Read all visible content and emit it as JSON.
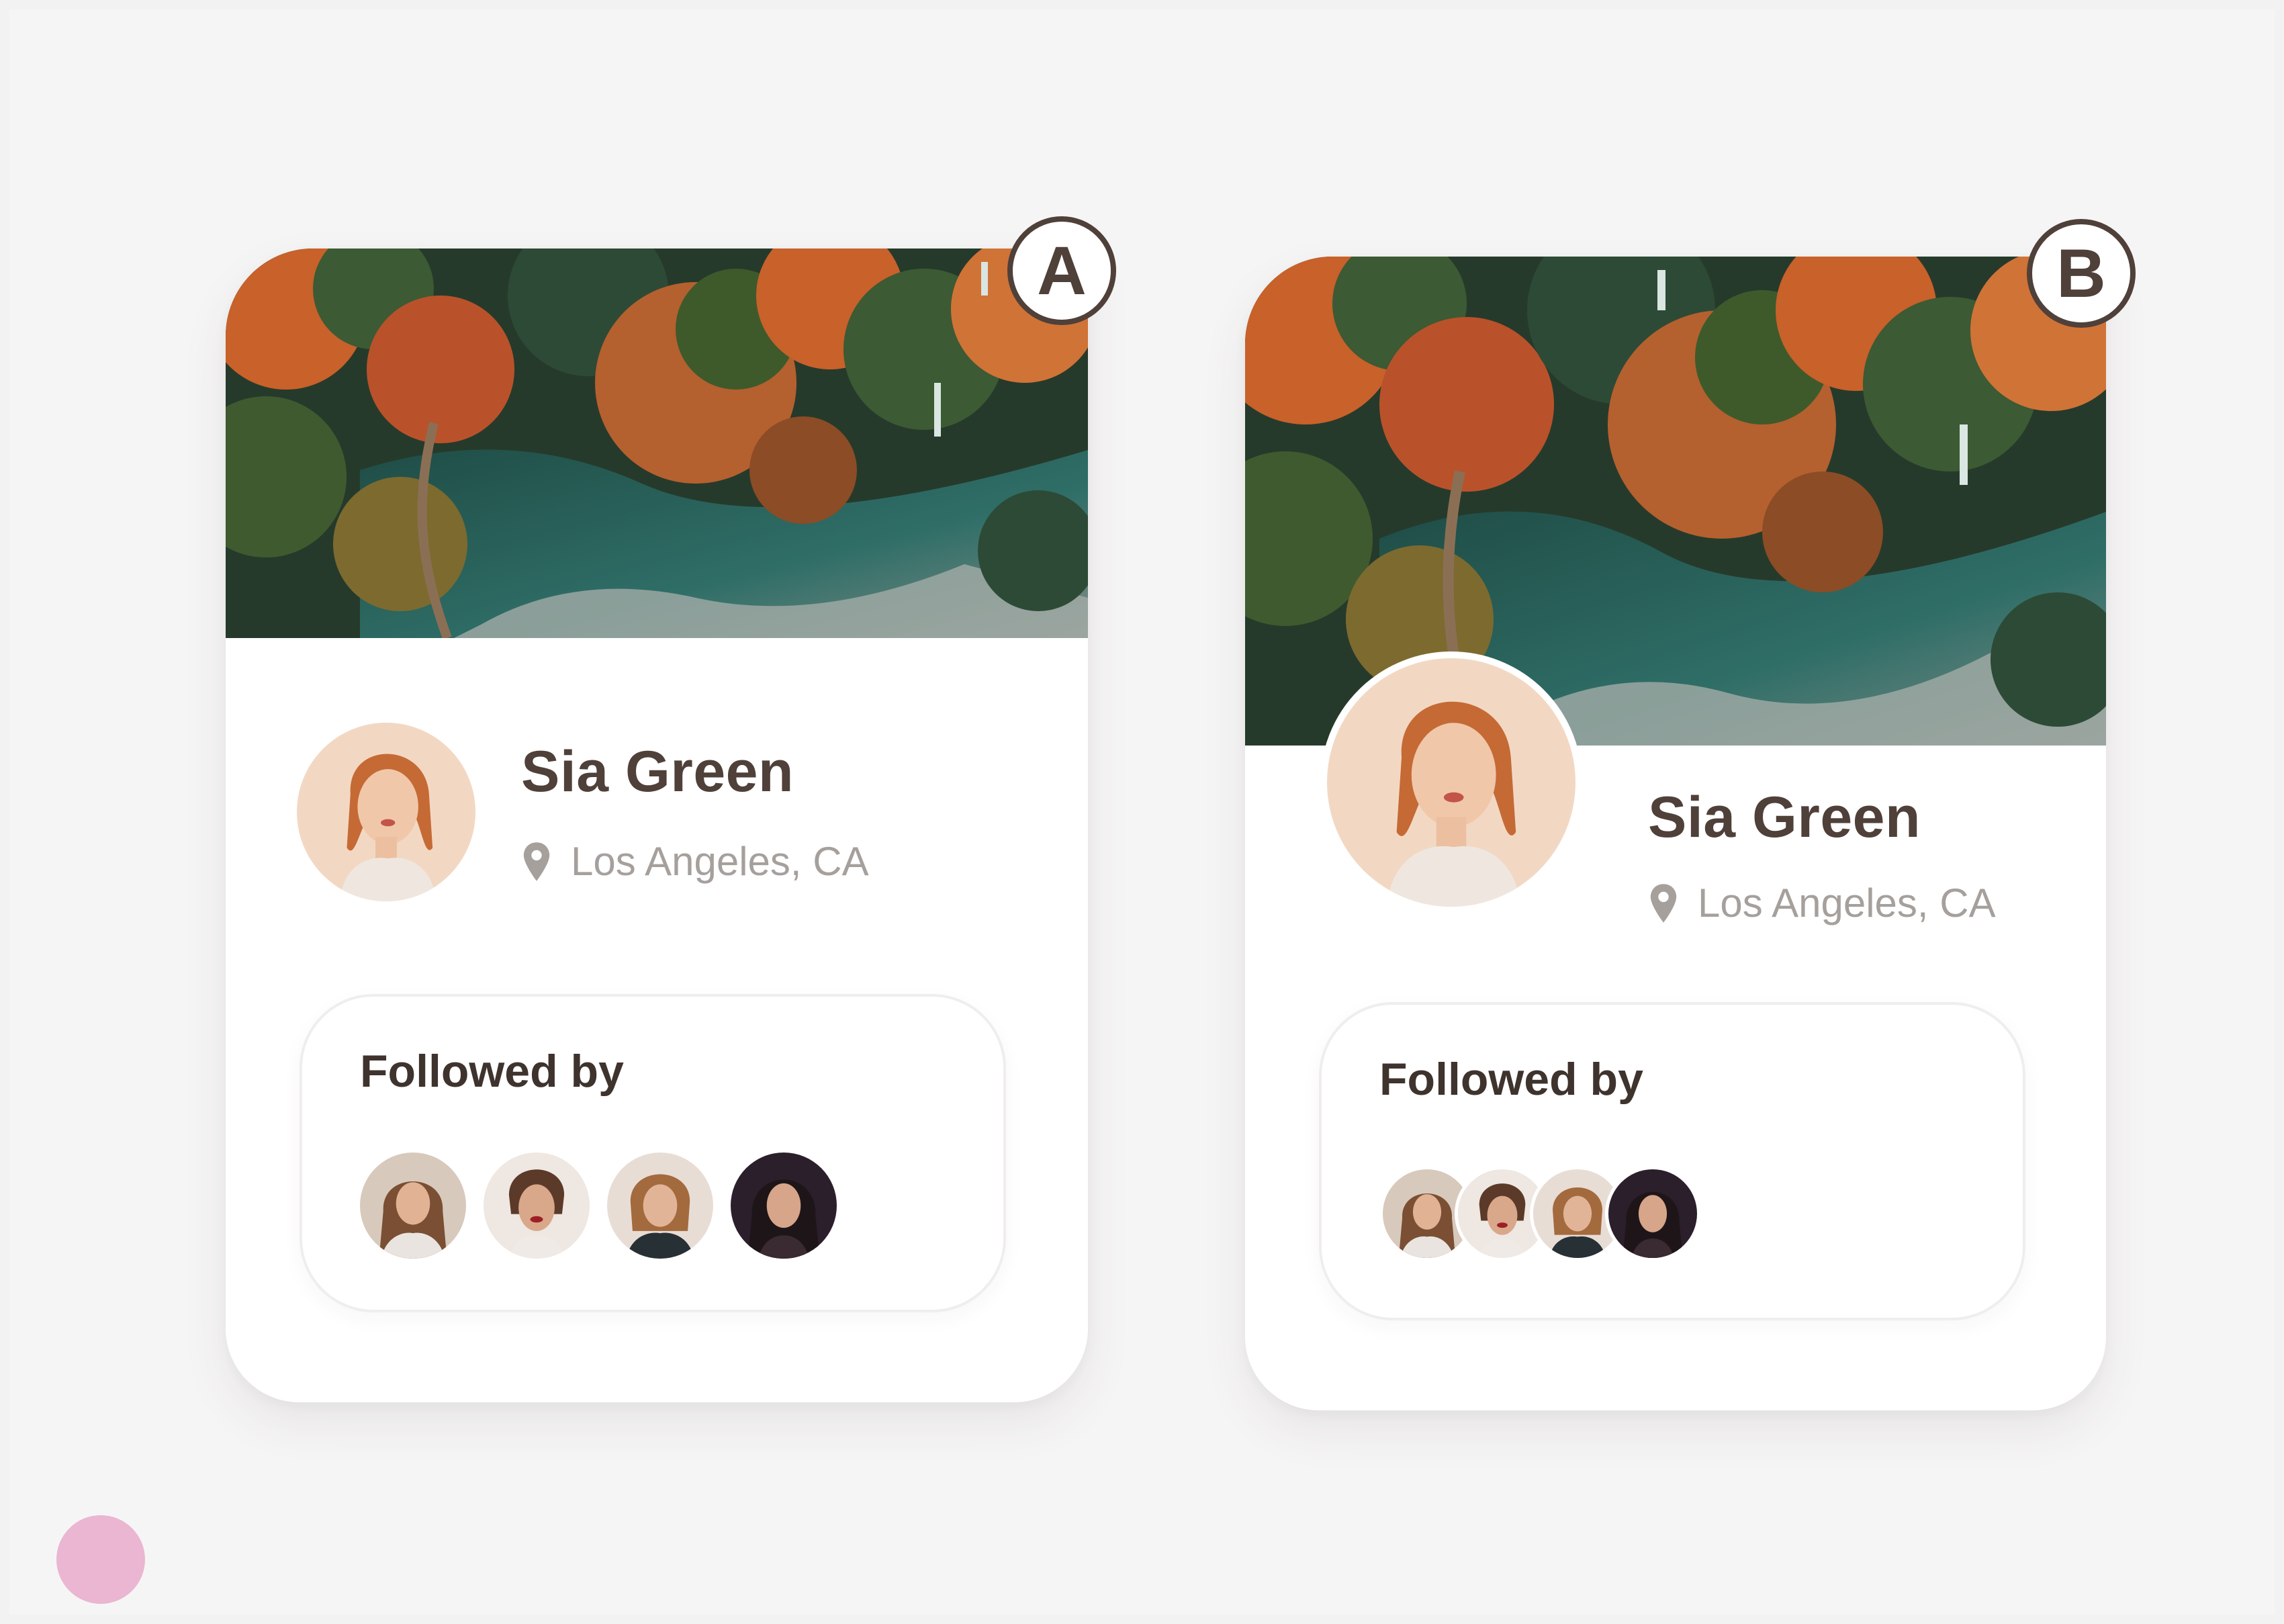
{
  "variants": [
    {
      "badge": "A",
      "profile": {
        "name": "Sia Green",
        "location": "Los Angeles, CA"
      },
      "followed": {
        "title": "Followed by",
        "avatars": [
          "follower-1",
          "follower-2",
          "follower-3",
          "follower-4"
        ]
      }
    },
    {
      "badge": "B",
      "profile": {
        "name": "Sia Green",
        "location": "Los Angeles, CA"
      },
      "followed": {
        "title": "Followed by",
        "avatars": [
          "follower-1",
          "follower-2",
          "follower-3",
          "follower-4"
        ]
      }
    }
  ],
  "colors": {
    "background": "#f6f5f5",
    "card": "#ffffff",
    "text_primary": "#4f4039",
    "text_secondary": "#a6a09d",
    "badge_border": "#4f4039",
    "decor_dot": "#eab6d2",
    "forest_green": "#2d4a36",
    "foliage_orange": "#c8612a",
    "water_teal": "#2f6e67"
  }
}
